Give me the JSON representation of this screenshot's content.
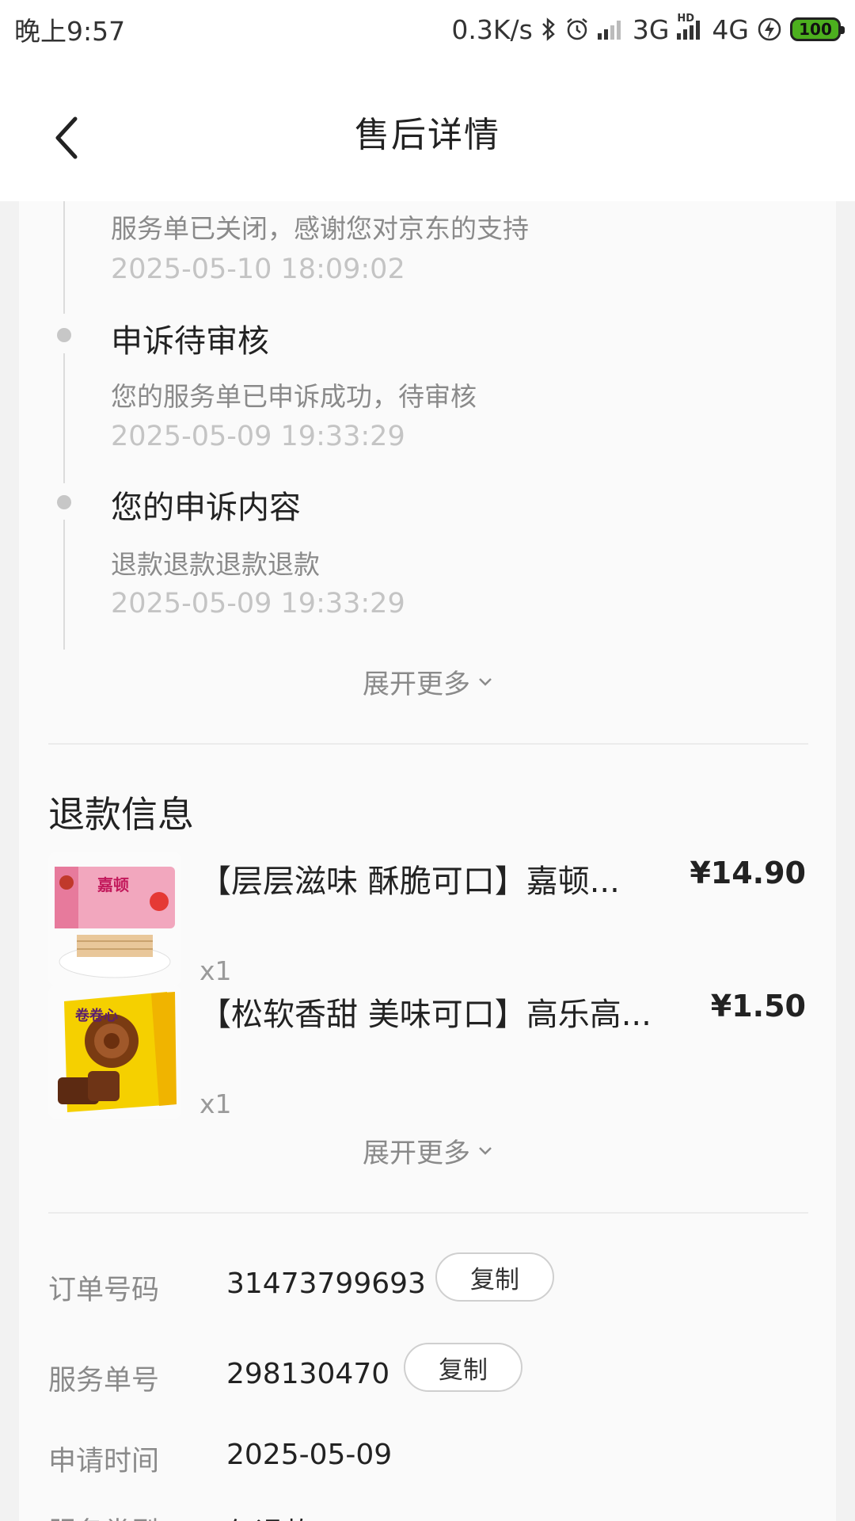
{
  "status_bar": {
    "time": "晚上9:57",
    "net_speed": "0.3K/s",
    "signal_3g": "3G",
    "hd_label": "HD",
    "signal_4g": "4G",
    "battery": "100"
  },
  "header": {
    "title": "售后详情"
  },
  "timeline": [
    {
      "title": "",
      "desc": "服务单已关闭，感谢您对京东的支持",
      "time": "2025-05-10 18:09:02"
    },
    {
      "title": "申诉待审核",
      "desc": "您的服务单已申诉成功，待审核",
      "time": "2025-05-09 19:33:29"
    },
    {
      "title": "您的申诉内容",
      "desc": "退款退款退款退款",
      "time": "2025-05-09 19:33:29"
    }
  ],
  "expand_label": "展开更多",
  "refund": {
    "section_title": "退款信息",
    "products": [
      {
        "name": "【层层滋味 酥脆可口】嘉顿...",
        "price": "¥14.90",
        "qty": "x1",
        "pack_text": "嘉顿"
      },
      {
        "name": "【松软香甜 美味可口】高乐高...",
        "price": "¥1.50",
        "qty": "x1",
        "pack_text": "卷卷心"
      }
    ],
    "expand_label": "展开更多"
  },
  "info": {
    "order_label": "订单号码",
    "order_value": "31473799693",
    "service_label": "服务单号",
    "service_value": "298130470",
    "apply_label": "申请时间",
    "apply_value": "2025-05-09",
    "type_label": "服务类型",
    "type_value": "仅退款",
    "copy_label": "复制"
  }
}
